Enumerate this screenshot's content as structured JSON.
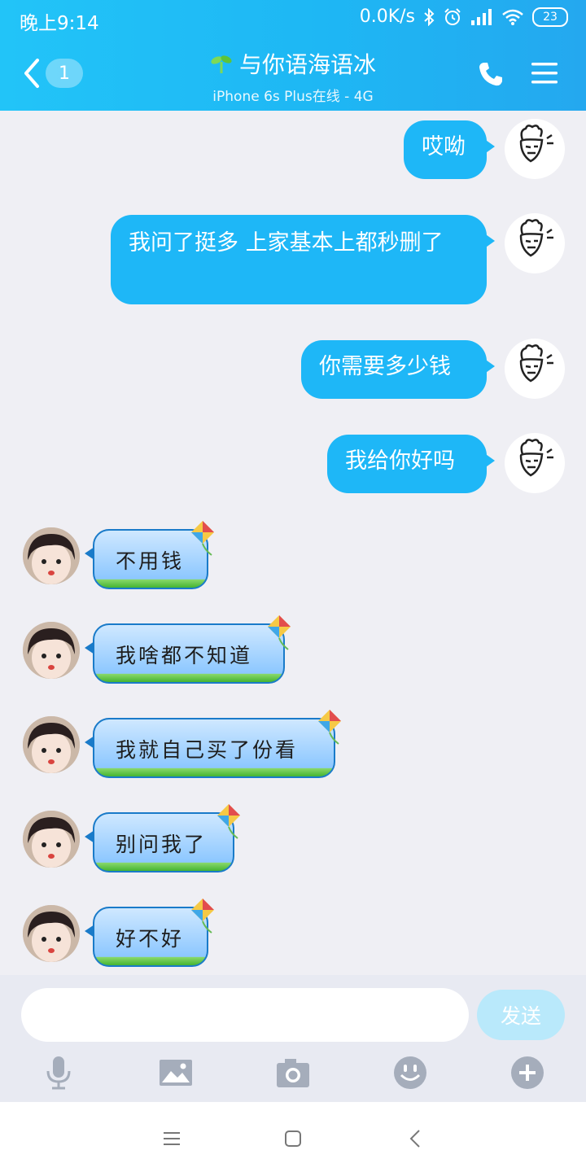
{
  "status_bar": {
    "time": "晚上9:14",
    "speed": "0.0K/s",
    "battery": "23"
  },
  "header": {
    "unread_count": "1",
    "contact_name": "与你语海语冰",
    "contact_status": "iPhone 6s Plus在线 - 4G"
  },
  "messages": [
    {
      "from": "me",
      "text": "哎呦"
    },
    {
      "from": "me",
      "text": "我问了挺多 上家基本上都秒删了"
    },
    {
      "from": "me",
      "text": "你需要多少钱"
    },
    {
      "from": "me",
      "text": "我给你好吗"
    },
    {
      "from": "her",
      "text": "不用钱"
    },
    {
      "from": "her",
      "text": "我啥都不知道"
    },
    {
      "from": "her",
      "text": "我就自己买了份看"
    },
    {
      "from": "her",
      "text": "别问我了"
    },
    {
      "from": "her",
      "text": "好不好"
    }
  ],
  "input": {
    "value": "",
    "send_label": "发送"
  },
  "toolbar_icons": [
    "microphone-icon",
    "image-icon",
    "camera-icon",
    "emoji-icon",
    "plus-icon"
  ],
  "colors": {
    "accent": "#1EB7F7",
    "header": "#22C4F8",
    "send_disabled": "#B9E9FB"
  }
}
